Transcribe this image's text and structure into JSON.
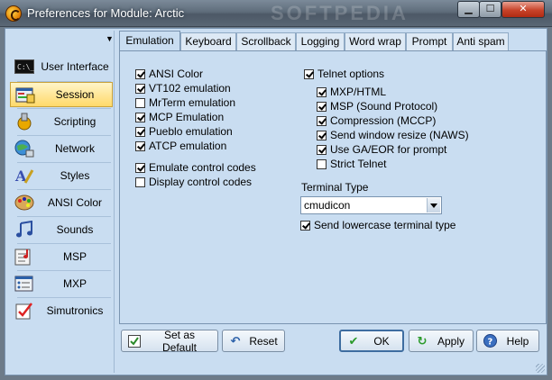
{
  "window": {
    "title": "Preferences for Module: Arctic",
    "watermark": "SOFTPEDIA"
  },
  "sidebar": {
    "items": [
      {
        "label": "User Interface",
        "icon": "terminal-icon"
      },
      {
        "label": "Session",
        "icon": "session-icon",
        "selected": true
      },
      {
        "label": "Scripting",
        "icon": "scripting-icon"
      },
      {
        "label": "Network",
        "icon": "network-icon"
      },
      {
        "label": "Styles",
        "icon": "styles-icon"
      },
      {
        "label": "ANSI Color",
        "icon": "palette-icon"
      },
      {
        "label": "Sounds",
        "icon": "music-icon"
      },
      {
        "label": "MSP",
        "icon": "msp-icon"
      },
      {
        "label": "MXP",
        "icon": "mxp-icon"
      },
      {
        "label": "Simutronics",
        "icon": "checklist-icon"
      }
    ]
  },
  "tabs": [
    "Emulation",
    "Keyboard",
    "Scrollback",
    "Logging",
    "Word wrap",
    "Prompt",
    "Anti spam"
  ],
  "active_tab": "Emulation",
  "emulation": {
    "left_group": [
      {
        "label": "ANSI Color",
        "checked": true
      },
      {
        "label": "VT102 emulation",
        "checked": true
      },
      {
        "label": "MrTerm emulation",
        "checked": false
      },
      {
        "label": "MCP Emulation",
        "checked": true
      },
      {
        "label": "Pueblo emulation",
        "checked": true
      },
      {
        "label": "ATCP emulation",
        "checked": true
      }
    ],
    "control_group": [
      {
        "label": "Emulate control codes",
        "checked": true
      },
      {
        "label": "Display control codes",
        "checked": false
      }
    ],
    "telnet": {
      "label": "Telnet options",
      "checked": true
    },
    "telnet_group": [
      {
        "label": "MXP/HTML",
        "checked": true
      },
      {
        "label": "MSP (Sound Protocol)",
        "checked": true
      },
      {
        "label": "Compression (MCCP)",
        "checked": true
      },
      {
        "label": "Send window resize (NAWS)",
        "checked": true
      },
      {
        "label": "Use GA/EOR for prompt",
        "checked": true
      },
      {
        "label": "Strict Telnet",
        "checked": false
      }
    ],
    "terminal_type_label": "Terminal Type",
    "terminal_type_value": "cmudicon",
    "send_lowercase": {
      "label": "Send lowercase terminal type",
      "checked": true
    }
  },
  "buttons": {
    "set_default": "Set as Default",
    "reset": "Reset",
    "ok": "OK",
    "apply": "Apply",
    "help": "Help"
  },
  "colors": {
    "panel_bg": "#c9ddf1",
    "selected_item": "#ffd96a"
  }
}
